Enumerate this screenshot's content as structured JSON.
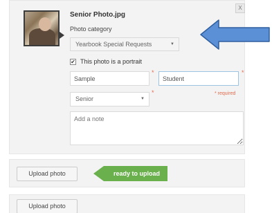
{
  "photo": {
    "filename": "Senior Photo.jpg",
    "close_label": "X"
  },
  "category": {
    "label": "Photo category",
    "selected": "Yearbook Special Requests",
    "caret": "▼"
  },
  "portrait": {
    "checked": true,
    "check_mark": "✔",
    "label": "This photo is a portrait"
  },
  "name": {
    "first_value": "Sample",
    "last_value": "Student",
    "required_star": "*"
  },
  "grade": {
    "selected": "Senior",
    "caret": "▼"
  },
  "required_note": "* required",
  "note": {
    "placeholder": "Add a note"
  },
  "upload": {
    "button_label": "Upload photo",
    "status": "ready to upload",
    "status_color": "#6ab04c"
  },
  "callout": {
    "arrow_color": "#5b8fd6",
    "arrow_outline": "#2f5f9e",
    "icon": "arrow-left-icon"
  }
}
